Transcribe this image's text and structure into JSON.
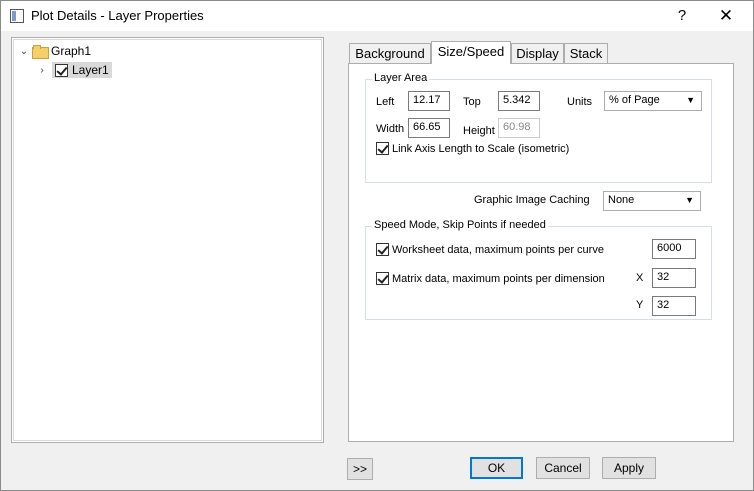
{
  "window": {
    "title": "Plot Details - Layer Properties",
    "help_symbol": "?",
    "close_symbol": "✕"
  },
  "tree": {
    "root": {
      "label": "Graph1",
      "expander": "⌄",
      "expanded": true,
      "icon": "folder-open-icon"
    },
    "child": {
      "label": "Layer1",
      "expander": "›",
      "checked": true,
      "selected": true
    }
  },
  "tabs": [
    {
      "label": "Background",
      "active": false
    },
    {
      "label": "Size/Speed",
      "active": true
    },
    {
      "label": "Display",
      "active": false
    },
    {
      "label": "Stack",
      "active": false
    }
  ],
  "layer_area": {
    "title": "Layer Area",
    "left_label": "Left",
    "left_value": "12.17",
    "top_label": "Top",
    "top_value": "5.342",
    "units_label": "Units",
    "units_value": "% of Page",
    "width_label": "Width",
    "width_value": "66.65",
    "height_label": "Height",
    "height_value": "60.98",
    "link_axis_label": "Link Axis Length to Scale (isometric)",
    "link_axis_checked": true
  },
  "caching": {
    "label": "Graphic Image Caching",
    "value": "None"
  },
  "speed_mode": {
    "title": "Speed Mode, Skip Points if needed",
    "worksheet_label": "Worksheet data, maximum points per curve",
    "worksheet_checked": true,
    "worksheet_value": "6000",
    "matrix_label": "Matrix data, maximum points per dimension",
    "matrix_checked": true,
    "x_label": "X",
    "x_value": "32",
    "y_label": "Y",
    "y_value": "32"
  },
  "buttons": {
    "expand_label": ">>",
    "ok_label": "OK",
    "cancel_label": "Cancel",
    "apply_label": "Apply"
  },
  "colors": {
    "accent": "#0078d7",
    "panel_bg": "#ffffff",
    "dialog_bg": "#f0f0f0"
  }
}
